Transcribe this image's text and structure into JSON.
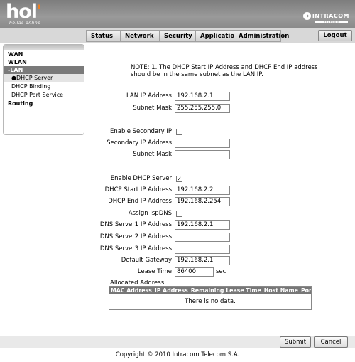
{
  "header": {
    "logo": "hol",
    "tagline": "hellas online",
    "brand": "INTRACOM",
    "brand_sub": "TELECOM"
  },
  "nav": {
    "tabs": [
      "Status",
      "Network",
      "Security",
      "Application",
      "Administration"
    ],
    "logout": "Logout"
  },
  "sidebar": {
    "wan": "WAN",
    "wlan": "WLAN",
    "lan": "-LAN",
    "dhcp_server": "DHCP Server",
    "dhcp_binding": "DHCP Binding",
    "dhcp_port_service": "DHCP Port Service",
    "routing": "Routing"
  },
  "form": {
    "note": "NOTE:  1. The DHCP Start IP Address and DHCP End IP address should be in the same subnet as the LAN IP.",
    "lan_ip_label": "LAN IP Address",
    "lan_ip": "192.168.2.1",
    "subnet_label": "Subnet Mask",
    "subnet": "255.255.255.0",
    "enable_secondary_label": "Enable Secondary IP",
    "enable_secondary": false,
    "secondary_ip_label": "Secondary IP Address",
    "secondary_ip": "",
    "secondary_subnet_label": "Subnet Mask",
    "secondary_subnet": "",
    "enable_dhcp_label": "Enable DHCP Server",
    "enable_dhcp": true,
    "dhcp_start_label": "DHCP Start IP Address",
    "dhcp_start": "192.168.2.2",
    "dhcp_end_label": "DHCP End IP Address",
    "dhcp_end": "192.168.2.254",
    "assign_isp_dns_label": "Assign IspDNS",
    "assign_isp_dns": false,
    "dns1_label": "DNS Server1 IP Address",
    "dns1": "192.168.2.1",
    "dns2_label": "DNS Server2 IP Address",
    "dns2": "",
    "dns3_label": "DNS Server3 IP Address",
    "dns3": "",
    "gateway_label": "Default Gateway",
    "gateway": "192.168.2.1",
    "lease_label": "Lease Time",
    "lease": "86400",
    "lease_unit": "sec",
    "check_mark": "✓"
  },
  "allocated": {
    "title": "Allocated Address",
    "columns": [
      "MAC Address",
      "IP Address",
      "Remaining Lease Time",
      "Host Name",
      "Port"
    ],
    "empty": "There is no data."
  },
  "buttons": {
    "submit": "Submit",
    "cancel": "Cancel"
  },
  "footer": {
    "copyright": "Copyright © 2010 Intracom Telecom S.A."
  }
}
